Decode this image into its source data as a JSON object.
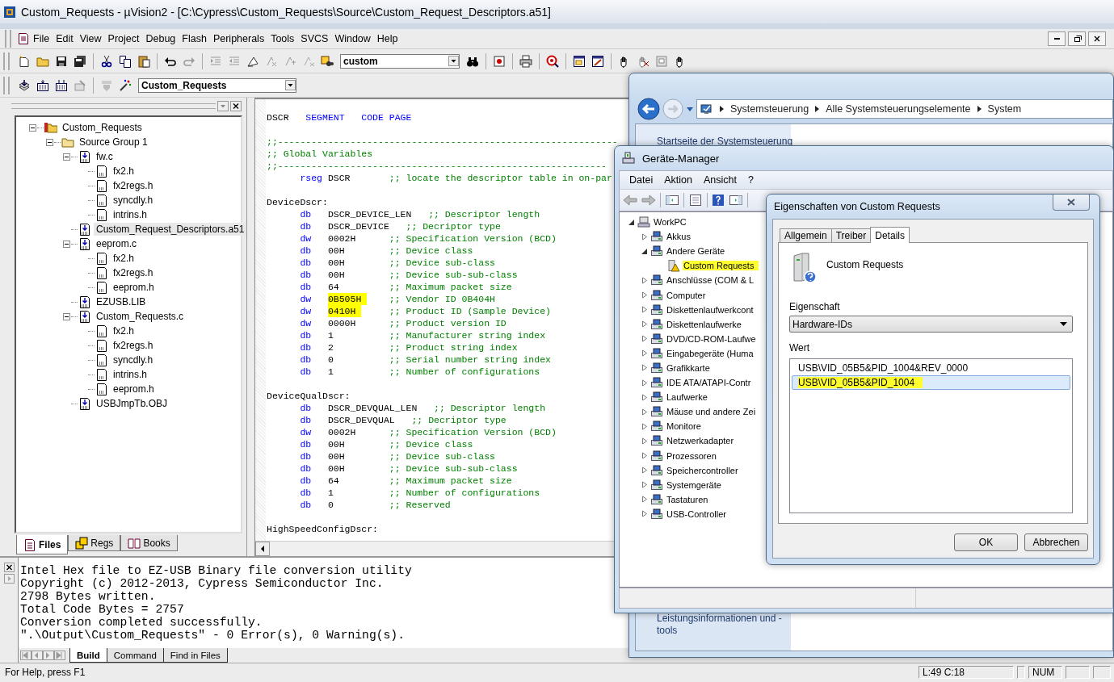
{
  "uvision": {
    "title": "Custom_Requests  - µVision2 - [C:\\Cypress\\Custom_Requests\\Source\\Custom_Request_Descriptors.a51]",
    "menu": [
      "File",
      "Edit",
      "View",
      "Project",
      "Debug",
      "Flash",
      "Peripherals",
      "Tools",
      "SVCS",
      "Window",
      "Help"
    ],
    "find_combo": "custom",
    "target_combo": "Custom_Requests",
    "project_tree": [
      {
        "label": "Custom_Requests",
        "kind": "project",
        "expanded": true,
        "selected": false,
        "children": [
          {
            "label": "Source Group 1",
            "kind": "group",
            "expanded": true,
            "selected": false,
            "children": [
              {
                "label": "fw.c",
                "kind": "source",
                "expanded": true,
                "selected": false,
                "children": [
                  {
                    "label": "fx2.h",
                    "kind": "header",
                    "selected": false
                  },
                  {
                    "label": "fx2regs.h",
                    "kind": "header",
                    "selected": false
                  },
                  {
                    "label": "syncdly.h",
                    "kind": "header",
                    "selected": false
                  },
                  {
                    "label": "intrins.h",
                    "kind": "header",
                    "selected": false
                  }
                ]
              },
              {
                "label": "Custom_Request_Descriptors.a51",
                "kind": "source",
                "selected": true
              },
              {
                "label": "eeprom.c",
                "kind": "source",
                "expanded": true,
                "selected": false,
                "children": [
                  {
                    "label": "fx2.h",
                    "kind": "header",
                    "selected": false
                  },
                  {
                    "label": "fx2regs.h",
                    "kind": "header",
                    "selected": false
                  },
                  {
                    "label": "eeprom.h",
                    "kind": "header",
                    "selected": false
                  }
                ]
              },
              {
                "label": "EZUSB.LIB",
                "kind": "source",
                "selected": false
              },
              {
                "label": "Custom_Requests.c",
                "kind": "source",
                "expanded": true,
                "selected": false,
                "children": [
                  {
                    "label": "fx2.h",
                    "kind": "header",
                    "selected": false
                  },
                  {
                    "label": "fx2regs.h",
                    "kind": "header",
                    "selected": false
                  },
                  {
                    "label": "syncdly.h",
                    "kind": "header",
                    "selected": false
                  },
                  {
                    "label": "intrins.h",
                    "kind": "header",
                    "selected": false
                  },
                  {
                    "label": "eeprom.h",
                    "kind": "header",
                    "selected": false
                  }
                ]
              },
              {
                "label": "USBJmpTb.OBJ",
                "kind": "source",
                "selected": false
              }
            ]
          }
        ]
      }
    ],
    "panel_tabs": [
      {
        "label": "Files",
        "selected": true
      },
      {
        "label": "Regs",
        "selected": false
      },
      {
        "label": "Books",
        "selected": false
      }
    ],
    "code_lines": [
      {
        "kind": "directive",
        "label": "DSCR",
        "op": "SEGMENT",
        "arg": "CODE PAGE"
      },
      {
        "kind": "blank"
      },
      {
        "kind": "comment",
        "text": ";;-------------------------------------------------------------"
      },
      {
        "kind": "comment",
        "text": ";; Global Variables"
      },
      {
        "kind": "comment",
        "text": ";;-----------------------------------------------------------"
      },
      {
        "kind": "instr",
        "op": "rseg",
        "arg": "DSCR",
        "comment": ";; locate the descriptor table in on-par",
        "highlighted": false
      },
      {
        "kind": "blank"
      },
      {
        "kind": "label",
        "text": "DeviceDscr:"
      },
      {
        "kind": "instr",
        "op": "db",
        "arg": "DSCR_DEVICE_LEN",
        "comment": ";; Descriptor length",
        "highlighted": false
      },
      {
        "kind": "instr",
        "op": "db",
        "arg": "DSCR_DEVICE",
        "comment": ";; Decriptor type",
        "highlighted": false
      },
      {
        "kind": "instr",
        "op": "dw",
        "arg": "0002H",
        "comment": ";; Specification Version (BCD)",
        "highlighted": false
      },
      {
        "kind": "instr",
        "op": "db",
        "arg": "00H",
        "comment": ";; Device class",
        "highlighted": false
      },
      {
        "kind": "instr",
        "op": "db",
        "arg": "00H",
        "comment": ";; Device sub-class",
        "highlighted": false
      },
      {
        "kind": "instr",
        "op": "db",
        "arg": "00H",
        "comment": ";; Device sub-sub-class",
        "highlighted": false
      },
      {
        "kind": "instr",
        "op": "db",
        "arg": "64",
        "comment": ";; Maximum packet size",
        "highlighted": false
      },
      {
        "kind": "instr",
        "op": "dw",
        "arg": "0B505H",
        "comment": ";; Vendor ID 0B404H",
        "highlighted": true
      },
      {
        "kind": "instr",
        "op": "dw",
        "arg": "0410H",
        "comment": ";; Product ID (Sample Device)",
        "highlighted": true
      },
      {
        "kind": "instr",
        "op": "dw",
        "arg": "0000H",
        "comment": ";; Product version ID",
        "highlighted": false
      },
      {
        "kind": "instr",
        "op": "db",
        "arg": "1",
        "comment": ";; Manufacturer string index",
        "highlighted": false
      },
      {
        "kind": "instr",
        "op": "db",
        "arg": "2",
        "comment": ";; Product string index",
        "highlighted": false
      },
      {
        "kind": "instr",
        "op": "db",
        "arg": "0",
        "comment": ";; Serial number string index",
        "highlighted": false
      },
      {
        "kind": "instr",
        "op": "db",
        "arg": "1",
        "comment": ";; Number of configurations",
        "highlighted": false
      },
      {
        "kind": "blank"
      },
      {
        "kind": "label",
        "text": "DeviceQualDscr:"
      },
      {
        "kind": "instr",
        "op": "db",
        "arg": "DSCR_DEVQUAL_LEN",
        "comment": ";; Descriptor length",
        "highlighted": false
      },
      {
        "kind": "instr",
        "op": "db",
        "arg": "DSCR_DEVQUAL",
        "comment": ";; Decriptor type",
        "highlighted": false
      },
      {
        "kind": "instr",
        "op": "dw",
        "arg": "0002H",
        "comment": ";; Specification Version (BCD)",
        "highlighted": false
      },
      {
        "kind": "instr",
        "op": "db",
        "arg": "00H",
        "comment": ";; Device class",
        "highlighted": false
      },
      {
        "kind": "instr",
        "op": "db",
        "arg": "00H",
        "comment": ";; Device sub-class",
        "highlighted": false
      },
      {
        "kind": "instr",
        "op": "db",
        "arg": "00H",
        "comment": ";; Device sub-sub-class",
        "highlighted": false
      },
      {
        "kind": "instr",
        "op": "db",
        "arg": "64",
        "comment": ";; Maximum packet size",
        "highlighted": false
      },
      {
        "kind": "instr",
        "op": "db",
        "arg": "1",
        "comment": ";; Number of configurations",
        "highlighted": false
      },
      {
        "kind": "instr",
        "op": "db",
        "arg": "0",
        "comment": ";; Reserved",
        "highlighted": false
      },
      {
        "kind": "blank"
      },
      {
        "kind": "label",
        "text": "HighSpeedConfigDscr:"
      }
    ],
    "output_lines": [
      "Intel Hex file to EZ-USB Binary file conversion utility",
      "Copyright (c) 2012-2013, Cypress Semiconductor Inc.",
      "2798 Bytes written.",
      "Total Code Bytes = 2757",
      "Conversion completed successfully.",
      "\".\\Output\\Custom_Requests\" - 0 Error(s), 0 Warning(s)."
    ],
    "output_tabs": [
      {
        "label": "Build",
        "selected": true
      },
      {
        "label": "Command",
        "selected": false
      },
      {
        "label": "Find in Files",
        "selected": false
      }
    ],
    "status_bar": {
      "help": "For Help, press F1",
      "position": "L:49 C:18",
      "num_lock": "NUM"
    }
  },
  "control_panel": {
    "breadcrumb": [
      "Systemsteuerung",
      "Alle Systemsteuerungselemente",
      "System"
    ],
    "sidebar_top_link": "Startseite der Systemsteuerung",
    "sidebar_bottom_link": "Leistungsinformationen und -tools"
  },
  "device_manager": {
    "title": "Geräte-Manager",
    "menu": [
      "Datei",
      "Aktion",
      "Ansicht",
      "?"
    ],
    "tree": [
      {
        "label": "WorkPC",
        "kind": "computer",
        "expanded": true,
        "highlighted": false,
        "children": [
          {
            "label": "Akkus",
            "kind": "category",
            "expanded": false,
            "highlighted": false
          },
          {
            "label": "Andere Geräte",
            "kind": "category",
            "expanded": true,
            "highlighted": false,
            "children": [
              {
                "label": "Custom Requests",
                "kind": "device",
                "highlighted": true
              }
            ]
          },
          {
            "label": "Anschlüsse (COM & L",
            "kind": "category",
            "expanded": false,
            "highlighted": false
          },
          {
            "label": "Computer",
            "kind": "category",
            "expanded": false,
            "highlighted": false
          },
          {
            "label": "Diskettenlaufwerkcont",
            "kind": "category",
            "expanded": false,
            "highlighted": false
          },
          {
            "label": "Diskettenlaufwerke",
            "kind": "category",
            "expanded": false,
            "highlighted": false
          },
          {
            "label": "DVD/CD-ROM-Laufwe",
            "kind": "category",
            "expanded": false,
            "highlighted": false
          },
          {
            "label": "Eingabegeräte (Huma",
            "kind": "category",
            "expanded": false,
            "highlighted": false
          },
          {
            "label": "Grafikkarte",
            "kind": "category",
            "expanded": false,
            "highlighted": false
          },
          {
            "label": "IDE ATA/ATAPI-Contr",
            "kind": "category",
            "expanded": false,
            "highlighted": false
          },
          {
            "label": "Laufwerke",
            "kind": "category",
            "expanded": false,
            "highlighted": false
          },
          {
            "label": "Mäuse und andere Zei",
            "kind": "category",
            "expanded": false,
            "highlighted": false
          },
          {
            "label": "Monitore",
            "kind": "category",
            "expanded": false,
            "highlighted": false
          },
          {
            "label": "Netzwerkadapter",
            "kind": "category",
            "expanded": false,
            "highlighted": false
          },
          {
            "label": "Prozessoren",
            "kind": "category",
            "expanded": false,
            "highlighted": false
          },
          {
            "label": "Speichercontroller",
            "kind": "category",
            "expanded": false,
            "highlighted": false
          },
          {
            "label": "Systemgeräte",
            "kind": "category",
            "expanded": false,
            "highlighted": false
          },
          {
            "label": "Tastaturen",
            "kind": "category",
            "expanded": false,
            "highlighted": false
          },
          {
            "label": "USB-Controller",
            "kind": "category",
            "expanded": false,
            "highlighted": false
          }
        ]
      }
    ]
  },
  "properties_dialog": {
    "title": "Eigenschaften von Custom Requests",
    "tabs": [
      {
        "label": "Allgemein",
        "selected": false
      },
      {
        "label": "Treiber",
        "selected": false
      },
      {
        "label": "Details",
        "selected": true
      }
    ],
    "device_name": "Custom Requests",
    "property_label": "Eigenschaft",
    "property_value": "Hardware-IDs",
    "value_label": "Wert",
    "values": [
      {
        "text": "USB\\VID_05B5&PID_1004&REV_0000",
        "selected": false,
        "highlighted": false
      },
      {
        "text": "USB\\VID_05B5&PID_1004",
        "selected": true,
        "highlighted": true
      }
    ],
    "buttons": [
      "OK",
      "Abbrechen"
    ]
  }
}
